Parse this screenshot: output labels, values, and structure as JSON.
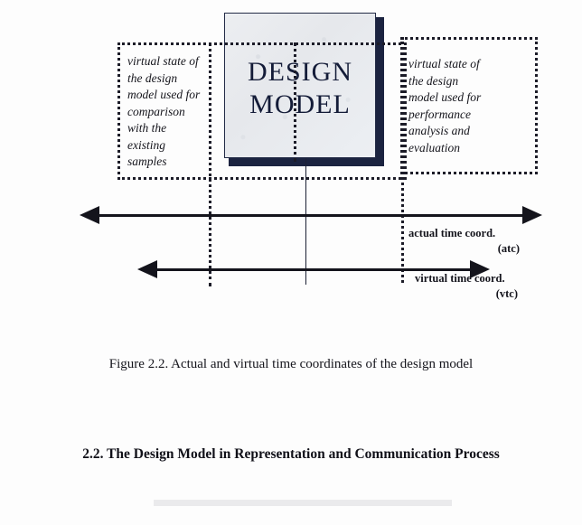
{
  "figure": {
    "design_model_box": {
      "label": "DESIGN\nMODEL",
      "fill_color": "#eceef1",
      "border_color": "#232b46",
      "shadow_color": "#1b2340"
    },
    "left_note": "virtual state of\nthe design\nmodel used for\ncomparison\nwith the\nexisting\nsamples",
    "right_note": "virtual state of\nthe design\nmodel used for\nperformance\nanalysis and\nevaluation",
    "axes": [
      {
        "name": "actual-time-coordinate",
        "label": "actual time coord.",
        "abbreviation": "(atc)",
        "direction": "bidirectional"
      },
      {
        "name": "virtual-time-coordinate",
        "label": "virtual time  coord.",
        "abbreviation": "(vtc)",
        "direction": "bidirectional"
      }
    ],
    "line_color": "#14141c",
    "dotted_color": "#1c1c28"
  },
  "caption": "Figure 2.2. Actual and virtual time coordinates of the design model",
  "section_heading": "2.2. The Design Model in Representation and Communication Process"
}
